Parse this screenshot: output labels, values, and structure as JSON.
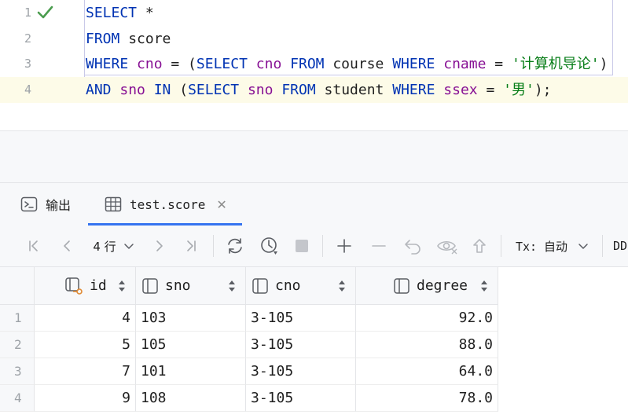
{
  "editor": {
    "line_numbers": [
      "1",
      "2",
      "3",
      "4"
    ],
    "lines": [
      [
        {
          "t": "SELECT",
          "c": "kw"
        },
        {
          "t": " *",
          "c": "pl"
        }
      ],
      [
        {
          "t": "FROM",
          "c": "kw"
        },
        {
          "t": " score",
          "c": "pl"
        }
      ],
      [
        {
          "t": "WHERE",
          "c": "kw"
        },
        {
          "t": " ",
          "c": "pl"
        },
        {
          "t": "cno",
          "c": "col"
        },
        {
          "t": " = (",
          "c": "pl"
        },
        {
          "t": "SELECT",
          "c": "kw"
        },
        {
          "t": " ",
          "c": "pl"
        },
        {
          "t": "cno",
          "c": "col"
        },
        {
          "t": " ",
          "c": "pl"
        },
        {
          "t": "FROM",
          "c": "kw"
        },
        {
          "t": " course ",
          "c": "pl"
        },
        {
          "t": "WHERE",
          "c": "kw"
        },
        {
          "t": " ",
          "c": "pl"
        },
        {
          "t": "cname",
          "c": "col"
        },
        {
          "t": " = ",
          "c": "pl"
        },
        {
          "t": "'计算机导论'",
          "c": "str"
        },
        {
          "t": ")",
          "c": "pl"
        }
      ],
      [
        {
          "t": "AND",
          "c": "kw"
        },
        {
          "t": " ",
          "c": "pl"
        },
        {
          "t": "sno",
          "c": "col"
        },
        {
          "t": " ",
          "c": "pl"
        },
        {
          "t": "IN",
          "c": "kw"
        },
        {
          "t": " (",
          "c": "pl"
        },
        {
          "t": "SELECT",
          "c": "kw"
        },
        {
          "t": " ",
          "c": "pl"
        },
        {
          "t": "sno",
          "c": "col"
        },
        {
          "t": " ",
          "c": "pl"
        },
        {
          "t": "FROM",
          "c": "kw"
        },
        {
          "t": " student ",
          "c": "pl"
        },
        {
          "t": "WHERE",
          "c": "kw"
        },
        {
          "t": " ",
          "c": "pl"
        },
        {
          "t": "ssex",
          "c": "col"
        },
        {
          "t": " = ",
          "c": "pl"
        },
        {
          "t": "'男'",
          "c": "str"
        },
        {
          "t": ");",
          "c": "pl"
        }
      ]
    ],
    "status_icon": "check-icon",
    "colors": {
      "keyword": "#0033b3",
      "column": "#871094",
      "string": "#067d17",
      "check": "#4a9c4e"
    }
  },
  "tabs": [
    {
      "label": "输出",
      "icon": "console-icon"
    },
    {
      "label": "test.score",
      "icon": "table-icon",
      "active": true
    }
  ],
  "toolbar": {
    "rows_label": "4 行",
    "tx_label": "Tx: 自动",
    "ddl_label": "DD"
  },
  "grid": {
    "columns": [
      {
        "name": "id",
        "icon": "key-column-icon"
      },
      {
        "name": "sno",
        "icon": "column-icon"
      },
      {
        "name": "cno",
        "icon": "column-icon"
      },
      {
        "name": "degree",
        "icon": "column-icon"
      }
    ],
    "rows": [
      {
        "n": "1",
        "id": "4",
        "sno": "103",
        "cno": "3-105",
        "degree": "92.0"
      },
      {
        "n": "2",
        "id": "5",
        "sno": "105",
        "cno": "3-105",
        "degree": "88.0"
      },
      {
        "n": "3",
        "id": "7",
        "sno": "101",
        "cno": "3-105",
        "degree": "64.0"
      },
      {
        "n": "4",
        "id": "9",
        "sno": "108",
        "cno": "3-105",
        "degree": "78.0"
      }
    ]
  }
}
